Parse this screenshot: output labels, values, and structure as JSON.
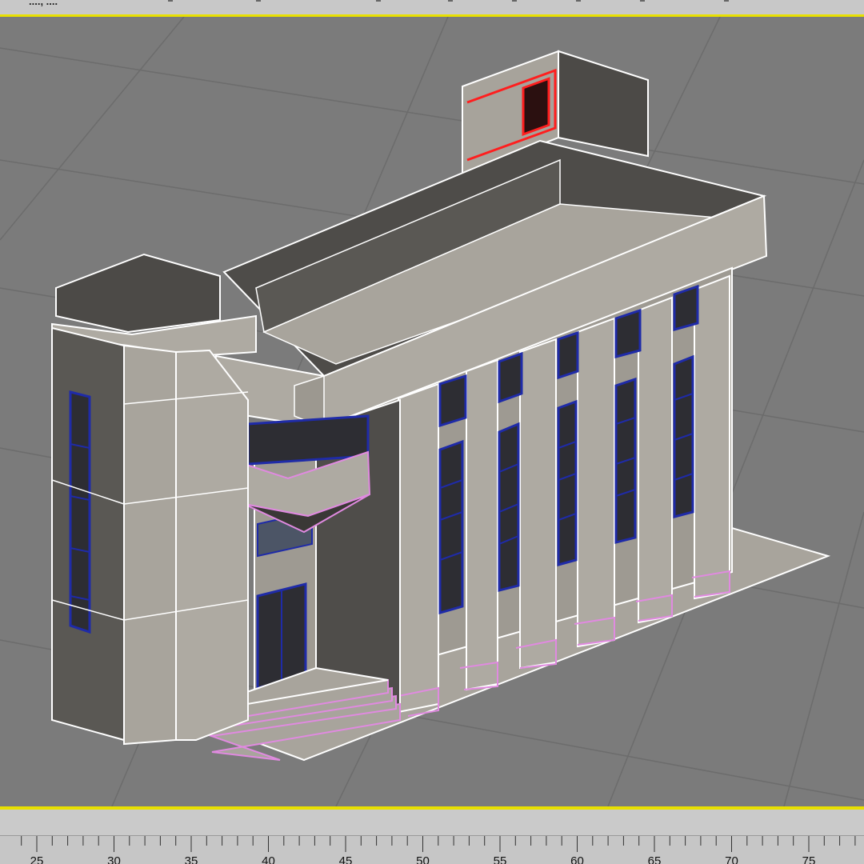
{
  "toolbar": {
    "label": "...., ...."
  },
  "viewport": {
    "view": "perspective",
    "background": "#7b7b7b",
    "grid_color": "#6c6c6c",
    "wire_color": "#ffffff",
    "window_color": "#1f2ba8",
    "selection_color": "#ff1e1e",
    "step_edge_color": "#e08ae0",
    "model": "building"
  },
  "timeline": {
    "ticks": [
      "25",
      "30",
      "35",
      "40",
      "45",
      "50",
      "55",
      "60",
      "65",
      "70",
      "75"
    ],
    "accent_color": "#e8e000"
  }
}
